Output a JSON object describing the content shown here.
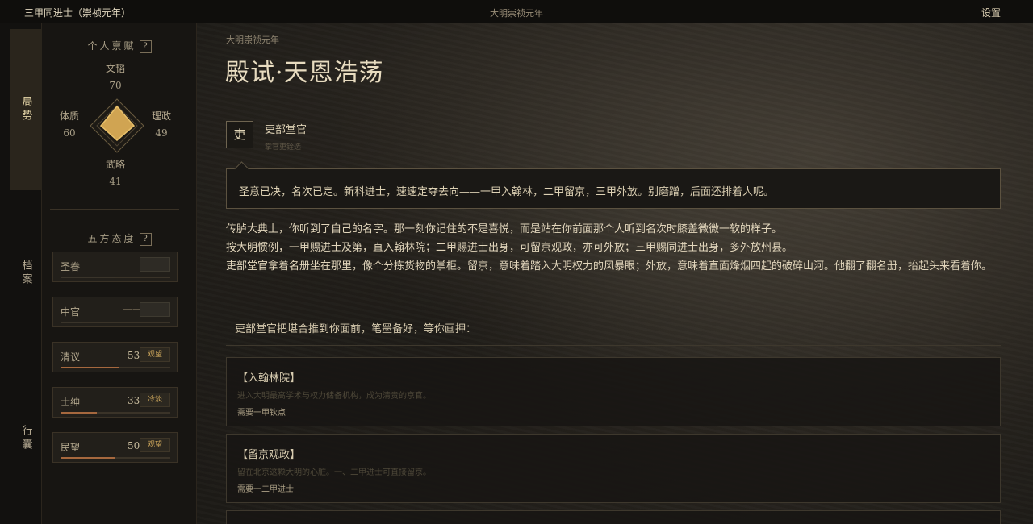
{
  "topbar": {
    "player_title": "三甲同进士（崇祯元年）",
    "era": "大明崇祯元年",
    "settings_label": "设置"
  },
  "nav": {
    "items": [
      {
        "label": "局势",
        "active": true
      },
      {
        "label": "档案",
        "active": false
      },
      {
        "label": "行囊",
        "active": false
      }
    ]
  },
  "talent": {
    "title": "个人禀赋",
    "help": "?",
    "stats": {
      "wenhan": {
        "label": "文韬",
        "value": "70"
      },
      "tizhi": {
        "label": "体质",
        "value": "60"
      },
      "lizheng": {
        "label": "理政",
        "value": "49"
      },
      "wulue": {
        "label": "武略",
        "value": "41"
      }
    }
  },
  "attitudes": {
    "title": "五方态度",
    "help": "?",
    "items": [
      {
        "name": "圣眷",
        "value": "——",
        "tag": "",
        "level": 0.5,
        "locked": true
      },
      {
        "name": "中官",
        "value": "——",
        "tag": "",
        "level": 0.2,
        "locked": true
      },
      {
        "name": "清议",
        "value": "53",
        "tag": "观望",
        "level": 0.53,
        "locked": false
      },
      {
        "name": "士绅",
        "value": "33",
        "tag": "冷淡",
        "level": 0.33,
        "locked": false
      },
      {
        "name": "民望",
        "value": "50",
        "tag": "观望",
        "level": 0.5,
        "locked": false
      }
    ]
  },
  "scene": {
    "breadcrumb": "大明崇祯元年",
    "title": "殿试·天恩浩荡",
    "npc": {
      "avatar_char": "吏",
      "name": "吏部堂官",
      "role": "掌官吏铨选"
    },
    "speech": "圣意已决，名次已定。新科进士，速速定夺去向——一甲入翰林，二甲留京，三甲外放。别磨蹭，后面还排着人呢。",
    "narration": [
      "传胪大典上，你听到了自己的名字。那一刻你记住的不是喜悦，而是站在你前面那个人听到名次时膝盖微微一软的样子。",
      "按大明惯例，一甲赐进士及第，直入翰林院；二甲赐进士出身，可留京观政，亦可外放；三甲赐同进士出身，多外放州县。",
      "吏部堂官拿着名册坐在那里，像个分拣货物的掌柜。留京，意味着踏入大明权力的风暴眼；外放，意味着直面烽烟四起的破碎山河。他翻了翻名册，抬起头来看着你。"
    ],
    "prompt": "吏部堂官把堪合推到你面前，笔墨备好，等你画押：",
    "choices": [
      {
        "title": "【入翰林院】",
        "desc": "进入大明最高学术与权力储备机构，成为清贵的京官。",
        "req": "需要一甲钦点"
      },
      {
        "title": "【留京观政】",
        "desc": "留在北京这颗大明的心脏。一、二甲进士可直接留京。",
        "req": "需要一二甲进士"
      }
    ]
  },
  "colors": {
    "accent_gold": "#b8943f",
    "bar_fill": "#a6683e",
    "tag_text": "#caa45a"
  }
}
